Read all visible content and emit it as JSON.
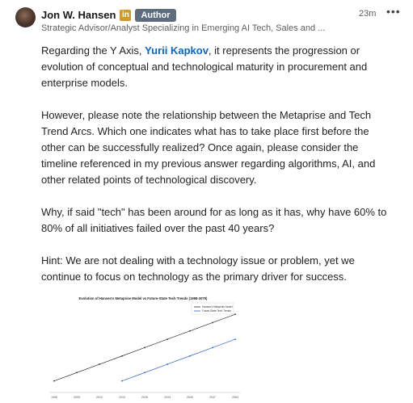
{
  "author": {
    "name": "Jon W. Hansen",
    "badge": "Author",
    "headline": "Strategic Advisor/Analyst Specializing in Emerging AI Tech, Sales and ...",
    "time": "23m",
    "more_label": "•••",
    "linkedin_badge": "in"
  },
  "comment": {
    "p1_before": "Regarding the Y Axis, ",
    "p1_mention": "Yurii Kapkov",
    "p1_after": ", it represents the progression or evolution of conceptual and technological maturity in procurement and enterprise models.",
    "p2": "However, please note the relationship between the Metaprise and Tech Trend Arcs. Which one indicates what has to take place first before the other can be successfully realized? Once again, please consider the timeline referenced in my previous answer regarding algorithms, AI, and other related points of technological discovery.",
    "p3": "Why, if said \"tech\" has been around for as long as it has, why have 60% to 80% of all initiatives failed over the past 40 years?",
    "p4": "Hint: We are not dealing with a technology issue or problem, yet we continue to focus on technology as the primary driver for success."
  },
  "colors": {
    "mention": "#0a66c2",
    "badge": "#5e6d7e",
    "linkedin": "#d19a28",
    "series_metaprise": "#333333",
    "series_tech": "#2f5fd0"
  },
  "chart_data": {
    "type": "line",
    "title": "Evolution of Hansen's Metaprise Model vs Future-State Tech Trends (1998-2075)",
    "x_ticks": [
      "1998",
      "2005",
      "2012",
      "2019",
      "2026",
      "2033",
      "2040",
      "2047",
      "2054"
    ],
    "series": [
      {
        "name": "Hansen's Metaprise Model",
        "x": [
          1998,
          2005,
          2012,
          2019,
          2026,
          2033,
          2040,
          2047,
          2054
        ],
        "y": [
          1,
          2,
          3,
          4,
          5,
          6,
          7,
          8,
          9
        ]
      },
      {
        "name": "Future-State Tech Trends",
        "x": [
          2019,
          2026,
          2033,
          2040,
          2047,
          2054
        ],
        "y": [
          1,
          2,
          3,
          4,
          5,
          6
        ]
      }
    ]
  }
}
